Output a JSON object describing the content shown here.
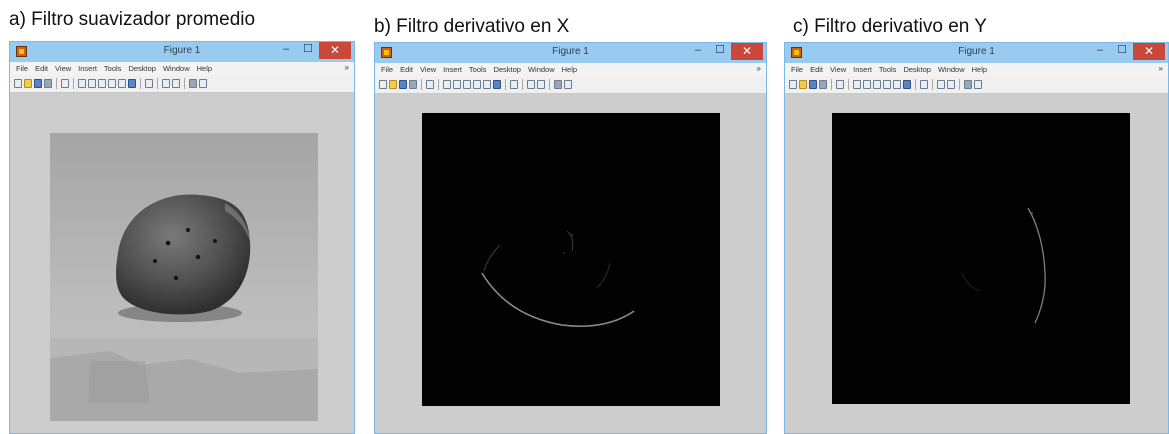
{
  "captions": {
    "a": "a) Filtro suavizador promedio",
    "b": "b) Filtro derivativo en X",
    "c": "c) Filtro derivativo en Y"
  },
  "windows": [
    {
      "title": "Figure 1",
      "minimize": "–",
      "maximize": "☐",
      "close": "✕",
      "menu": [
        "File",
        "Edit",
        "View",
        "Insert",
        "Tools",
        "Desktop",
        "Window",
        "Help"
      ]
    },
    {
      "title": "Figure 1",
      "minimize": "–",
      "maximize": "☐",
      "close": "✕",
      "menu": [
        "File",
        "Edit",
        "View",
        "Insert",
        "Tools",
        "Desktop",
        "Window",
        "Help"
      ]
    },
    {
      "title": "Figure 1",
      "minimize": "–",
      "maximize": "☐",
      "close": "✕",
      "menu": [
        "File",
        "Edit",
        "View",
        "Insert",
        "Tools",
        "Desktop",
        "Window",
        "Help"
      ]
    }
  ],
  "menu_overflow": "»",
  "colors": {
    "title_bar": "#99cbf0",
    "close_button": "#c9483a",
    "window_bg": "#cdcdcd"
  }
}
